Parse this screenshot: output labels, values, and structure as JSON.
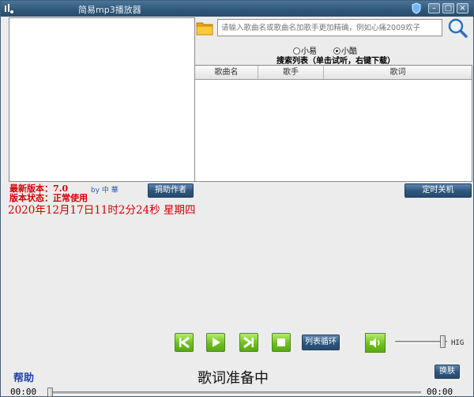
{
  "window": {
    "title": "简易mp3播放器",
    "minimize_glyph": "–",
    "maximize_glyph": "□",
    "close_glyph": "×"
  },
  "search": {
    "placeholder": "请输入歌曲名或歌曲名加歌手更加精确，例如心痛2009欢子",
    "value": "",
    "sources": [
      {
        "label": "小易",
        "selected": false
      },
      {
        "label": "小酷",
        "selected": true
      }
    ],
    "list_caption": "搜索列表（单击试听，右键下载）",
    "columns": [
      "歌曲名",
      "歌手",
      "歌词"
    ]
  },
  "buttons": {
    "donate": "捐助作者",
    "shutdown_timer": "定时关机",
    "loop_mode": "列表循环",
    "skin": "换肤"
  },
  "info": {
    "version": "最新版本：7.0",
    "status": "版本状态：正常使用",
    "author": "by 中 華",
    "datetime": "2020年12月17日11时2分24秒  星期四"
  },
  "player": {
    "help": "帮助",
    "lyric_status": "歌词准备中",
    "current_time": "00:00",
    "total_time": "00:00",
    "volume_label": "HIG",
    "volume_level": 0.92,
    "progress": 0
  },
  "colors": {
    "titlebar": "#2f5676",
    "accent_green": "#6fbf22",
    "info_red": "#d20000",
    "help_blue": "#1d3fa8"
  },
  "icons": [
    "app-icon",
    "shield-icon",
    "folder-icon",
    "search-icon",
    "previous-icon",
    "play-icon",
    "next-icon",
    "stop-icon",
    "volume-icon"
  ]
}
